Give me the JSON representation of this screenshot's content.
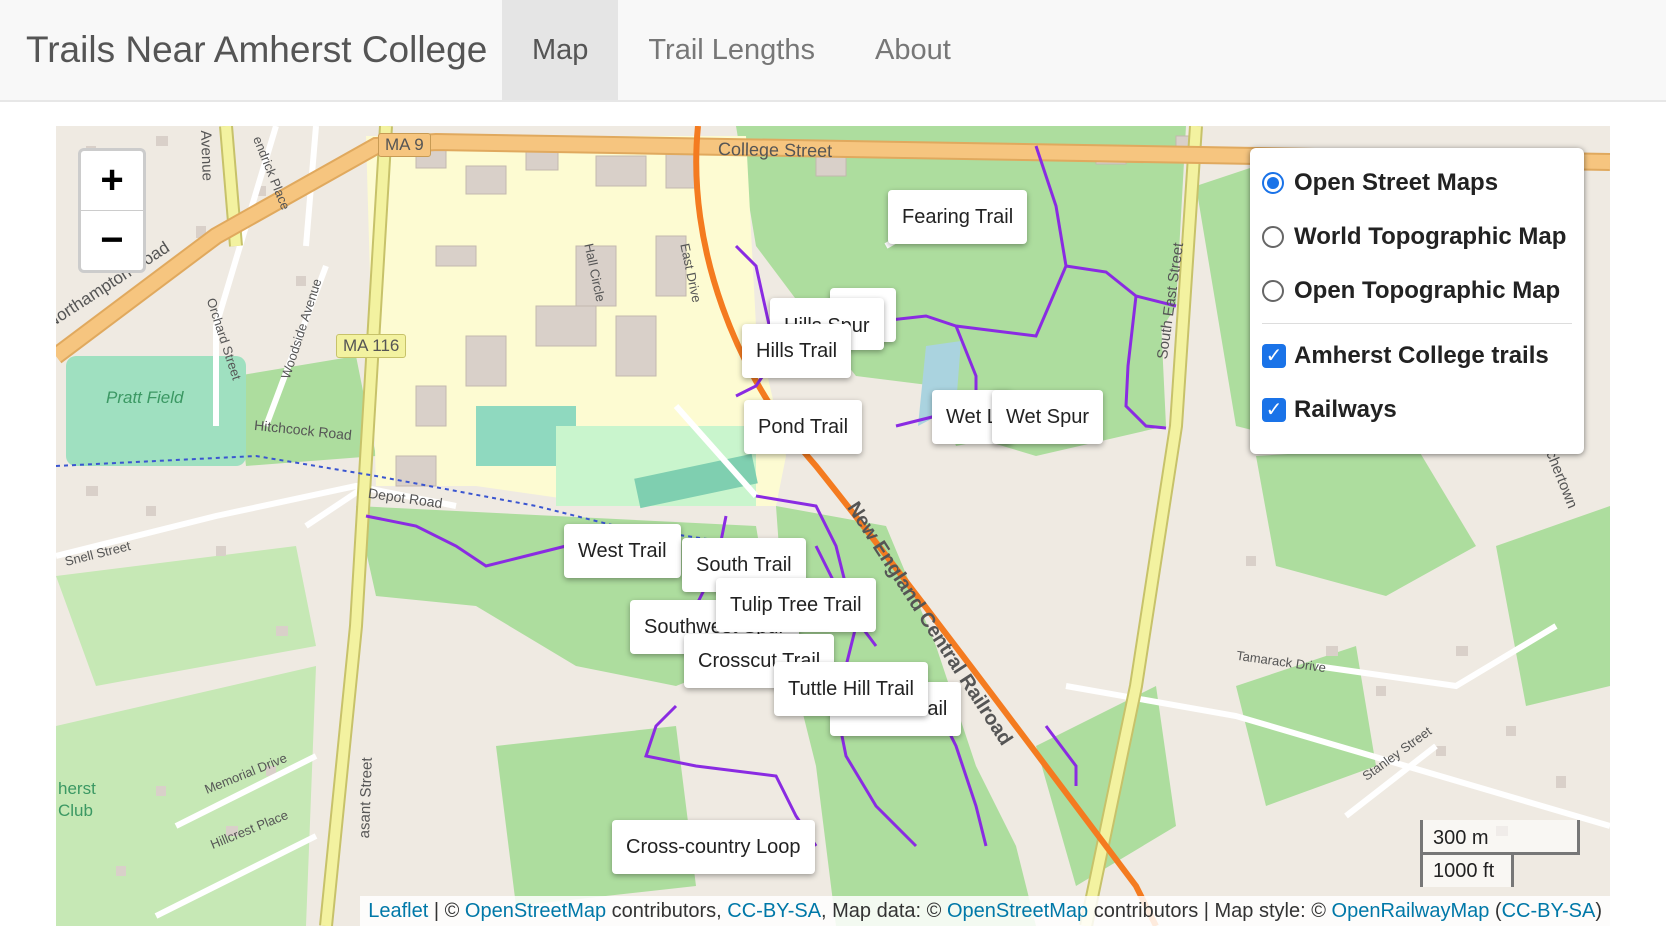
{
  "navbar": {
    "brand": "Trails Near Amherst College",
    "links": [
      "Map",
      "Trail Lengths",
      "About"
    ],
    "active": "Map"
  },
  "zoom": {
    "in": "+",
    "out": "−"
  },
  "map_labels": {
    "ma9": "MA 9",
    "ma116": "MA 116",
    "college_street": "College Street",
    "northampton_road": "Northampton Road",
    "orchard_street": "Orchard Street",
    "woodside_avenue": "Woodside Avenue",
    "pratt_field": "Pratt Field",
    "hitchcock_road": "Hitchcock Road",
    "depot_road": "Depot Road",
    "snell_street": "Snell Street",
    "east_drive": "East Drive",
    "hall_circle": "Hall Circle",
    "railroad": "New England Central Railroad",
    "south_east_street": "South East Street",
    "tamarack_drive": "Tamarack Drive",
    "stanley_street": "Stanley Street",
    "memorial_drive": "Memorial Drive",
    "hillcrest_place": "Hillcrest Place",
    "pleasant_street": "asant Street",
    "hendrick_place": "endrick Place",
    "avenue": "Avenue",
    "amherst_club": "herst Club",
    "belchertown": "chertown"
  },
  "trail_tooltips": [
    "Fearing Trail",
    "Hills Spur",
    "Trail",
    "Hills Trail",
    "Pond Trail",
    "Wet L",
    "Wet Spur",
    "West Trail",
    "South Trail",
    "Tulip Tree Trail",
    "Southwest Spur",
    "Crosscut Trail",
    "Tuttle Hill Trail",
    "d Plow Trail",
    "Cross-country Loop"
  ],
  "layer_control": {
    "base_layers": [
      "Open Street Maps",
      "World Topographic Map",
      "Open Topographic Map"
    ],
    "selected_base": "Open Street Maps",
    "overlays": [
      "Amherst College trails",
      "Railways"
    ],
    "overlays_checked": [
      true,
      true
    ]
  },
  "scale": {
    "metric": "300 m",
    "imperial": "1000 ft"
  },
  "attribution": {
    "leaflet": "Leaflet",
    "sep1": " | © ",
    "osm1": "OpenStreetMap",
    "mid1": " contributors, ",
    "ccbysa1": "CC-BY-SA",
    "mid2": ", Map data: © ",
    "osm2": "OpenStreetMap",
    "mid3": " contributors | Map style: © ",
    "orm": "OpenRailwayMap",
    "open": " (",
    "ccbysa2": "CC-BY-SA",
    "close": ")"
  },
  "colors": {
    "trail": "#8a2be2",
    "railway": "#f47b20",
    "major_road": "#f6c57f",
    "secondary_road": "#f3f2a0",
    "forest": "#addd9e",
    "campus": "#fdfbd2",
    "map_background": "#efeae2",
    "accent": "#1a73e8"
  }
}
